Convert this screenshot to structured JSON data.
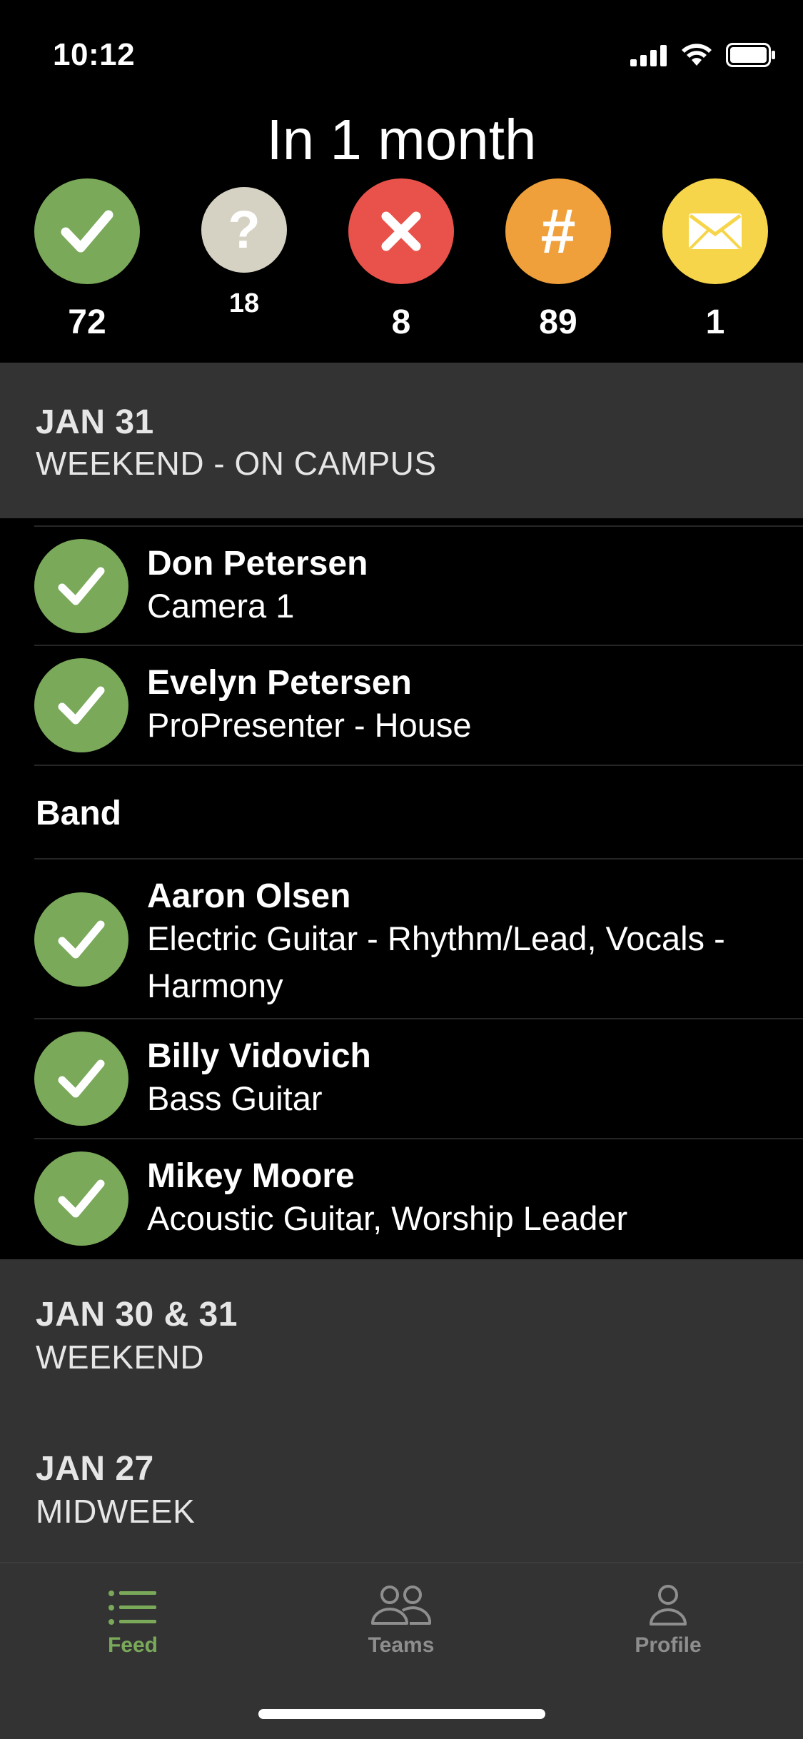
{
  "status_bar": {
    "time": "10:12"
  },
  "header": {
    "title": "In 1 month"
  },
  "stats": [
    {
      "name": "accepted",
      "icon": "check-icon",
      "color": "#7aa95a",
      "count": "72"
    },
    {
      "name": "pending",
      "icon": "question-icon",
      "color": "#d5d2c3",
      "count": "18"
    },
    {
      "name": "declined",
      "icon": "x-icon",
      "color": "#e9524a",
      "count": "8"
    },
    {
      "name": "scheduled",
      "icon": "hash-icon",
      "color": "#f0a03a",
      "count": "89"
    },
    {
      "name": "messages",
      "icon": "mail-icon",
      "color": "#f7d54a",
      "count": "1"
    }
  ],
  "sections": [
    {
      "date": "JAN 31",
      "subtitle": "WEEKEND - ON CAMPUS",
      "people": [
        {
          "name": "Don Petersen",
          "role": "Camera 1"
        },
        {
          "name": "Evelyn Petersen",
          "role": "ProPresenter - House"
        }
      ],
      "groups": [
        {
          "label": "Band",
          "people": [
            {
              "name": "Aaron Olsen",
              "role": "Electric Guitar - Rhythm/Lead, Vocals - Harmony"
            },
            {
              "name": "Billy Vidovich",
              "role": "Bass Guitar"
            },
            {
              "name": "Mikey Moore",
              "role": "Acoustic Guitar, Worship Leader"
            }
          ]
        }
      ]
    },
    {
      "date": "JAN 30 & 31",
      "subtitle": "WEEKEND"
    },
    {
      "date": "JAN 27",
      "subtitle": "MIDWEEK"
    }
  ],
  "tabbar": {
    "items": [
      {
        "label": "Feed",
        "icon": "list-icon",
        "active": true
      },
      {
        "label": "Teams",
        "icon": "people-icon",
        "active": false
      },
      {
        "label": "Profile",
        "icon": "person-icon",
        "active": false
      }
    ],
    "accent": "#7aa95a"
  }
}
